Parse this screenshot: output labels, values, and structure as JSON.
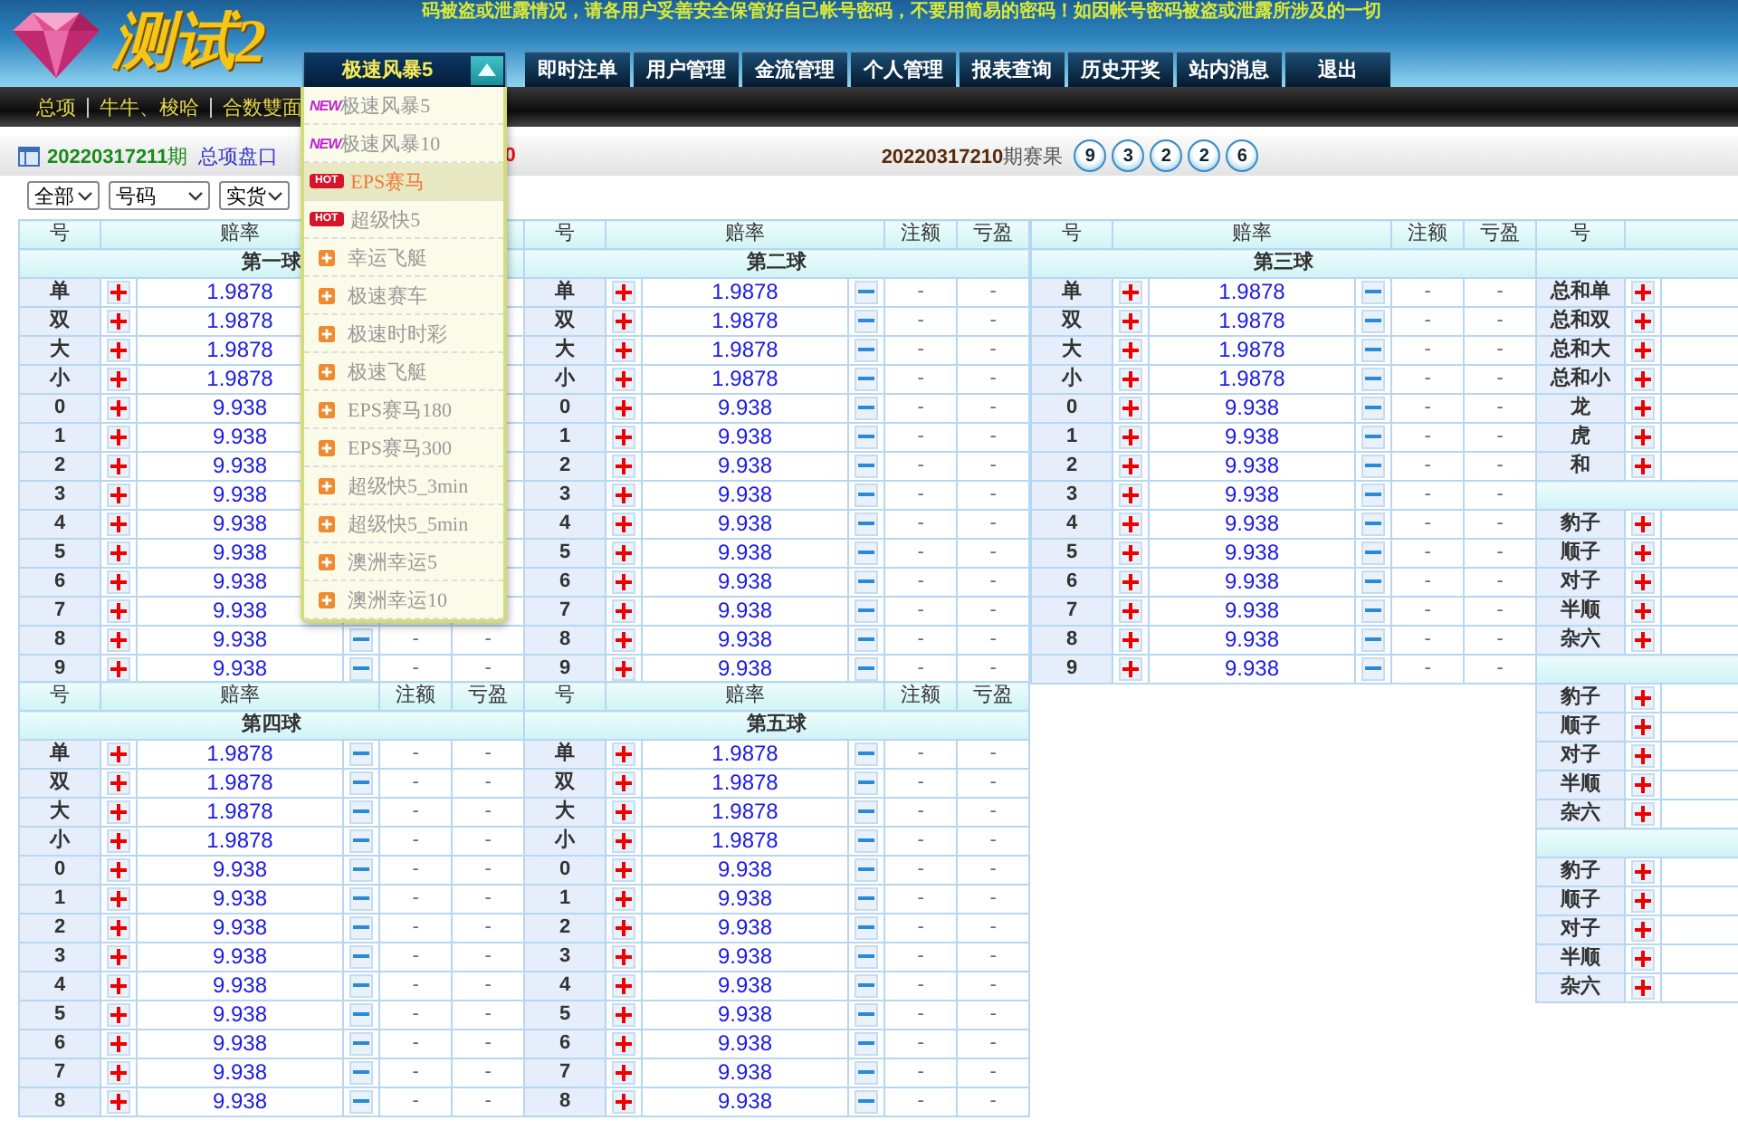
{
  "logo": {
    "text": "测试2"
  },
  "notice": "码被盗或泄露情况，请各用户妥善安全保管好自己帐号密码，不要用简易的密码！如因帐号密码被盗或泄露所涉及的一切",
  "game_select": {
    "value": "极速风暴5",
    "expanded": true
  },
  "nav_tabs": [
    "即时注单",
    "用户管理",
    "金流管理",
    "个人管理",
    "报表查询",
    "历史开奖",
    "站内消息",
    "退出"
  ],
  "sub_nav": [
    "总项",
    "牛牛、梭哈",
    "合数雙面"
  ],
  "game_menu": [
    {
      "kind": "new",
      "badge": "NEW",
      "label": "极速风暴5",
      "selected": false
    },
    {
      "kind": "new",
      "badge": "NEW",
      "label": "极速风暴10",
      "selected": false
    },
    {
      "kind": "hot",
      "badge": "HOT",
      "label": "EPS赛马",
      "selected": true
    },
    {
      "kind": "hot",
      "badge": "HOT",
      "label": "超级快5",
      "selected": false
    },
    {
      "kind": "plain",
      "label": "幸运飞艇",
      "selected": false
    },
    {
      "kind": "plain",
      "label": "极速赛车",
      "selected": false
    },
    {
      "kind": "plain",
      "label": "极速时时彩",
      "selected": false
    },
    {
      "kind": "plain",
      "label": "极速飞艇",
      "selected": false
    },
    {
      "kind": "plain",
      "label": "EPS赛马180",
      "selected": false
    },
    {
      "kind": "plain",
      "label": "EPS赛马300",
      "selected": false
    },
    {
      "kind": "plain",
      "label": "超级快5_3min",
      "selected": false
    },
    {
      "kind": "plain",
      "label": "超级快5_5min",
      "selected": false
    },
    {
      "kind": "plain",
      "label": "澳洲幸运5",
      "selected": false
    },
    {
      "kind": "plain",
      "label": "澳洲幸运10",
      "selected": false
    }
  ],
  "info_bar": {
    "period": "20220317211",
    "period_suffix": "期",
    "market": "总项盘口",
    "countdown": "0",
    "last_period": "20220317210",
    "last_suffix": "期赛果",
    "balls": [
      "9",
      "3",
      "2",
      "2",
      "6"
    ]
  },
  "filters": [
    "全部",
    "号码",
    "实货"
  ],
  "ball_tables": [
    {
      "title": "第一球",
      "columns": [
        "号",
        "赔率"
      ],
      "rows": [
        {
          "label": "单",
          "odds": "1.9878"
        },
        {
          "label": "双",
          "odds": "1.9878"
        },
        {
          "label": "大",
          "odds": "1.9878"
        },
        {
          "label": "小",
          "odds": "1.9878"
        },
        {
          "label": "0",
          "odds": "9.938"
        },
        {
          "label": "1",
          "odds": "9.938"
        },
        {
          "label": "2",
          "odds": "9.938"
        },
        {
          "label": "3",
          "odds": "9.938"
        },
        {
          "label": "4",
          "odds": "9.938"
        },
        {
          "label": "5",
          "odds": "9.938"
        },
        {
          "label": "6",
          "odds": "9.938"
        },
        {
          "label": "7",
          "odds": "9.938"
        },
        {
          "label": "8",
          "odds": "9.938",
          "stake": "-",
          "profit": "-"
        },
        {
          "label": "9",
          "odds": "9.938",
          "stake": "-",
          "profit": "-"
        }
      ]
    },
    {
      "title": "第二球",
      "columns": [
        "号",
        "赔率",
        "注额",
        "亏盈"
      ],
      "rows": [
        {
          "label": "单",
          "odds": "1.9878",
          "stake": "-",
          "profit": "-"
        },
        {
          "label": "双",
          "odds": "1.9878",
          "stake": "-",
          "profit": "-"
        },
        {
          "label": "大",
          "odds": "1.9878",
          "stake": "-",
          "profit": "-"
        },
        {
          "label": "小",
          "odds": "1.9878",
          "stake": "-",
          "profit": "-"
        },
        {
          "label": "0",
          "odds": "9.938",
          "stake": "-",
          "profit": "-"
        },
        {
          "label": "1",
          "odds": "9.938",
          "stake": "-",
          "profit": "-"
        },
        {
          "label": "2",
          "odds": "9.938",
          "stake": "-",
          "profit": "-"
        },
        {
          "label": "3",
          "odds": "9.938",
          "stake": "-",
          "profit": "-"
        },
        {
          "label": "4",
          "odds": "9.938",
          "stake": "-",
          "profit": "-"
        },
        {
          "label": "5",
          "odds": "9.938",
          "stake": "-",
          "profit": "-"
        },
        {
          "label": "6",
          "odds": "9.938",
          "stake": "-",
          "profit": "-"
        },
        {
          "label": "7",
          "odds": "9.938",
          "stake": "-",
          "profit": "-"
        },
        {
          "label": "8",
          "odds": "9.938",
          "stake": "-",
          "profit": "-"
        },
        {
          "label": "9",
          "odds": "9.938",
          "stake": "-",
          "profit": "-"
        }
      ]
    },
    {
      "title": "第三球",
      "columns": [
        "号",
        "赔率",
        "注额",
        "亏盈"
      ],
      "rows": [
        {
          "label": "单",
          "odds": "1.9878",
          "stake": "-",
          "profit": "-"
        },
        {
          "label": "双",
          "odds": "1.9878",
          "stake": "-",
          "profit": "-"
        },
        {
          "label": "大",
          "odds": "1.9878",
          "stake": "-",
          "profit": "-"
        },
        {
          "label": "小",
          "odds": "1.9878",
          "stake": "-",
          "profit": "-"
        },
        {
          "label": "0",
          "odds": "9.938",
          "stake": "-",
          "profit": "-"
        },
        {
          "label": "1",
          "odds": "9.938",
          "stake": "-",
          "profit": "-"
        },
        {
          "label": "2",
          "odds": "9.938",
          "stake": "-",
          "profit": "-"
        },
        {
          "label": "3",
          "odds": "9.938",
          "stake": "-",
          "profit": "-"
        },
        {
          "label": "4",
          "odds": "9.938",
          "stake": "-",
          "profit": "-"
        },
        {
          "label": "5",
          "odds": "9.938",
          "stake": "-",
          "profit": "-"
        },
        {
          "label": "6",
          "odds": "9.938",
          "stake": "-",
          "profit": "-"
        },
        {
          "label": "7",
          "odds": "9.938",
          "stake": "-",
          "profit": "-"
        },
        {
          "label": "8",
          "odds": "9.938",
          "stake": "-",
          "profit": "-"
        },
        {
          "label": "9",
          "odds": "9.938",
          "stake": "-",
          "profit": "-"
        }
      ]
    },
    {
      "title": "第四球",
      "columns": [
        "号",
        "赔率",
        "注额",
        "亏盈"
      ],
      "rows": [
        {
          "label": "单",
          "odds": "1.9878",
          "stake": "-",
          "profit": "-"
        },
        {
          "label": "双",
          "odds": "1.9878",
          "stake": "-",
          "profit": "-"
        },
        {
          "label": "大",
          "odds": "1.9878",
          "stake": "-",
          "profit": "-"
        },
        {
          "label": "小",
          "odds": "1.9878",
          "stake": "-",
          "profit": "-"
        },
        {
          "label": "0",
          "odds": "9.938",
          "stake": "-",
          "profit": "-"
        },
        {
          "label": "1",
          "odds": "9.938",
          "stake": "-",
          "profit": "-"
        },
        {
          "label": "2",
          "odds": "9.938",
          "stake": "-",
          "profit": "-"
        },
        {
          "label": "3",
          "odds": "9.938",
          "stake": "-",
          "profit": "-"
        },
        {
          "label": "4",
          "odds": "9.938",
          "stake": "-",
          "profit": "-"
        },
        {
          "label": "5",
          "odds": "9.938",
          "stake": "-",
          "profit": "-"
        },
        {
          "label": "6",
          "odds": "9.938",
          "stake": "-",
          "profit": "-"
        },
        {
          "label": "7",
          "odds": "9.938",
          "stake": "-",
          "profit": "-"
        },
        {
          "label": "8",
          "odds": "9.938",
          "stake": "-",
          "profit": "-"
        }
      ]
    },
    {
      "title": "第五球",
      "columns": [
        "号",
        "赔率",
        "注额",
        "亏盈"
      ],
      "rows": [
        {
          "label": "单",
          "odds": "1.9878",
          "stake": "-",
          "profit": "-"
        },
        {
          "label": "双",
          "odds": "1.9878",
          "stake": "-",
          "profit": "-"
        },
        {
          "label": "大",
          "odds": "1.9878",
          "stake": "-",
          "profit": "-"
        },
        {
          "label": "小",
          "odds": "1.9878",
          "stake": "-",
          "profit": "-"
        },
        {
          "label": "0",
          "odds": "9.938",
          "stake": "-",
          "profit": "-"
        },
        {
          "label": "1",
          "odds": "9.938",
          "stake": "-",
          "profit": "-"
        },
        {
          "label": "2",
          "odds": "9.938",
          "stake": "-",
          "profit": "-"
        },
        {
          "label": "3",
          "odds": "9.938",
          "stake": "-",
          "profit": "-"
        },
        {
          "label": "4",
          "odds": "9.938",
          "stake": "-",
          "profit": "-"
        },
        {
          "label": "5",
          "odds": "9.938",
          "stake": "-",
          "profit": "-"
        },
        {
          "label": "6",
          "odds": "9.938",
          "stake": "-",
          "profit": "-"
        },
        {
          "label": "7",
          "odds": "9.938",
          "stake": "-",
          "profit": "-"
        },
        {
          "label": "8",
          "odds": "9.938",
          "stake": "-",
          "profit": "-"
        }
      ]
    }
  ],
  "side_panel": {
    "columns": [
      "号"
    ],
    "groups": [
      {
        "rows": [
          "总和单",
          "总和双",
          "总和大",
          "总和小",
          "龙",
          "虎",
          "和"
        ]
      },
      {
        "rows": [
          "豹子",
          "顺子",
          "对子",
          "半顺",
          "杂六"
        ]
      },
      {
        "rows": [
          "豹子",
          "顺子",
          "对子",
          "半顺",
          "杂六"
        ]
      },
      {
        "rows": [
          "豹子",
          "顺子",
          "对子",
          "半顺",
          "杂六"
        ]
      }
    ]
  }
}
